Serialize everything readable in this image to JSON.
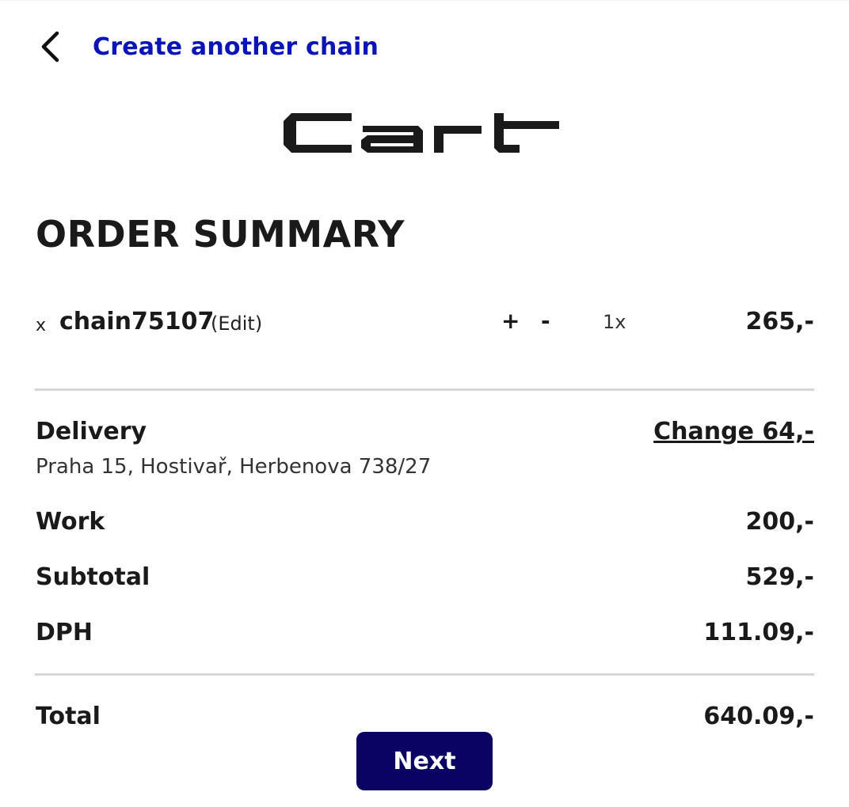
{
  "header": {
    "back_label": "Create another chain",
    "logo_text": "Cart"
  },
  "page_title": "ORDER SUMMARY",
  "cart": {
    "items": [
      {
        "remove_label": "x",
        "name": "chain75107",
        "edit_label": "(Edit)",
        "plus_label": "+",
        "minus_label": "-",
        "quantity": "1x",
        "price": "265,-"
      }
    ]
  },
  "summary": {
    "delivery": {
      "label": "Delivery",
      "change_label": "Change 64,-",
      "address": "Praha 15, Hostivař, Herbenova 738/27"
    },
    "work": {
      "label": "Work",
      "value": "200,-"
    },
    "subtotal": {
      "label": "Subtotal",
      "value": "529,-"
    },
    "dph": {
      "label": "DPH",
      "value": "111.09,-"
    },
    "total": {
      "label": "Total",
      "value": "640.09,-"
    }
  },
  "actions": {
    "next_label": "Next"
  },
  "colors": {
    "link": "#0a14b8",
    "button_bg": "#0a0363",
    "divider": "#d6d6d6",
    "text": "#1a1a1a"
  }
}
